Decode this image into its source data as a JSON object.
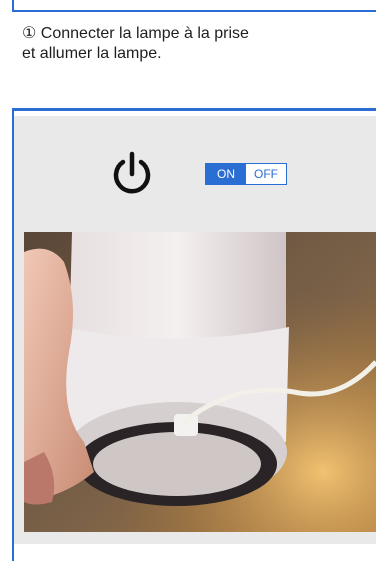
{
  "step_text": "① Connecter la lampe à la prise\net allumer la lampe.",
  "switch": {
    "on_label": "ON",
    "off_label": "OFF",
    "state": "ON"
  },
  "colors": {
    "accent": "#2b6ed3",
    "panel_bg": "#e9e9e9"
  },
  "icons": {
    "power": "power-icon"
  }
}
